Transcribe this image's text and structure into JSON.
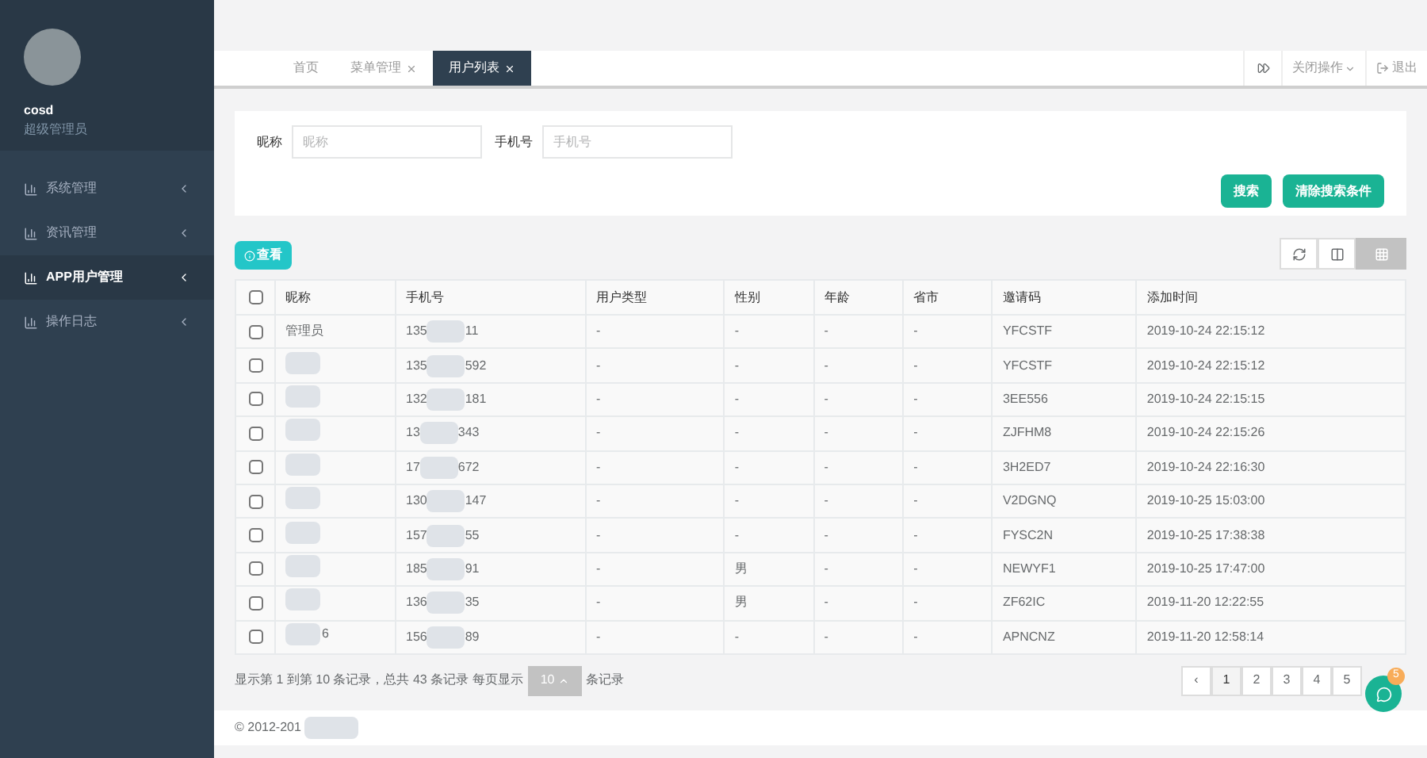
{
  "user": {
    "name": "cosd",
    "role": "超级管理员"
  },
  "menu": [
    {
      "label": "系统管理",
      "selected": false
    },
    {
      "label": "资讯管理",
      "selected": false
    },
    {
      "label": "APP用户管理",
      "selected": true
    },
    {
      "label": "操作日志",
      "selected": false
    }
  ],
  "tabs": [
    {
      "label": "首页",
      "selected": false
    },
    {
      "label": "菜单管理",
      "selected": false
    },
    {
      "label": "用户列表",
      "selected": true
    }
  ],
  "top_actions": {
    "close": "关闭操作",
    "logout": "退出"
  },
  "search": {
    "fields": [
      {
        "label": "昵称",
        "placeholder": "昵称"
      },
      {
        "label": "手机号",
        "placeholder": "手机号"
      }
    ],
    "buttons": [
      "搜索",
      "清除搜索条件"
    ]
  },
  "view_button": "查看",
  "table": {
    "select_all_checked": false,
    "columns": [
      "昵称",
      "手机号",
      "用户类型",
      "性别",
      "年龄",
      "省市",
      "邀请码",
      "添加时间"
    ],
    "rows": [
      {
        "checked": false,
        "nickname": "管理员",
        "nickname_blurred": false,
        "phone_start": "135",
        "phone_end": "11",
        "type": "-",
        "gender": "-",
        "age": "-",
        "region": "-",
        "code": "YFCSTF",
        "time": "2019-10-24 22:15:12"
      },
      {
        "checked": false,
        "nickname_blurred": true,
        "phone_start": "135",
        "phone_end": "592",
        "type": "-",
        "gender": "-",
        "age": "-",
        "region": "-",
        "code": "YFCSTF",
        "time": "2019-10-24 22:15:12"
      },
      {
        "checked": false,
        "nickname_blurred": true,
        "phone_start": "132",
        "phone_end": "181",
        "type": "-",
        "gender": "-",
        "age": "-",
        "region": "-",
        "code": "3EE556",
        "time": "2019-10-24 22:15:15"
      },
      {
        "checked": false,
        "nickname_blurred": true,
        "phone_start": "13",
        "phone_end": "343",
        "type": "-",
        "gender": "-",
        "age": "-",
        "region": "-",
        "code": "ZJFHM8",
        "time": "2019-10-24 22:15:26"
      },
      {
        "checked": false,
        "nickname_blurred": true,
        "phone_start": "17",
        "phone_end": "672",
        "type": "-",
        "gender": "-",
        "age": "-",
        "region": "-",
        "code": "3H2ED7",
        "time": "2019-10-24 22:16:30"
      },
      {
        "checked": false,
        "nickname_blurred": true,
        "phone_start": "130",
        "phone_end": "147",
        "type": "-",
        "gender": "-",
        "age": "-",
        "region": "-",
        "code": "V2DGNQ",
        "time": "2019-10-25 15:03:00"
      },
      {
        "checked": false,
        "nickname_blurred": true,
        "phone_start": "157",
        "phone_end": "55",
        "type": "-",
        "gender": "-",
        "age": "-",
        "region": "-",
        "code": "FYSC2N",
        "time": "2019-10-25 17:38:38"
      },
      {
        "checked": false,
        "nickname_blurred": true,
        "phone_start": "185",
        "phone_end": "91",
        "type": "-",
        "gender": "男",
        "age": "-",
        "region": "-",
        "code": "NEWYF1",
        "time": "2019-10-25 17:47:00"
      },
      {
        "checked": false,
        "nickname_blurred": true,
        "phone_start": "136",
        "phone_end": "35",
        "type": "-",
        "gender": "男",
        "age": "-",
        "region": "-",
        "code": "ZF62IC",
        "time": "2019-11-20 12:22:55"
      },
      {
        "checked": false,
        "nickname": "6",
        "nickname_blurred": true,
        "phone_start": "156",
        "phone_end": "89",
        "type": "-",
        "gender": "-",
        "age": "-",
        "region": "-",
        "code": "APNCNZ",
        "time": "2019-11-20 12:58:14"
      }
    ]
  },
  "pagination": {
    "summary": "显示第 1 到第 10 条记录，总共 43 条记录 每页显示",
    "page_size": "10",
    "suffix": "条记录",
    "prev": "‹",
    "pages": [
      {
        "label": "1",
        "selected": true
      },
      {
        "label": "2",
        "selected": false
      },
      {
        "label": "3",
        "selected": false
      },
      {
        "label": "4",
        "selected": false
      },
      {
        "label": "5",
        "selected": false
      }
    ]
  },
  "chat_badge": "5",
  "footer": "© 2012-201"
}
